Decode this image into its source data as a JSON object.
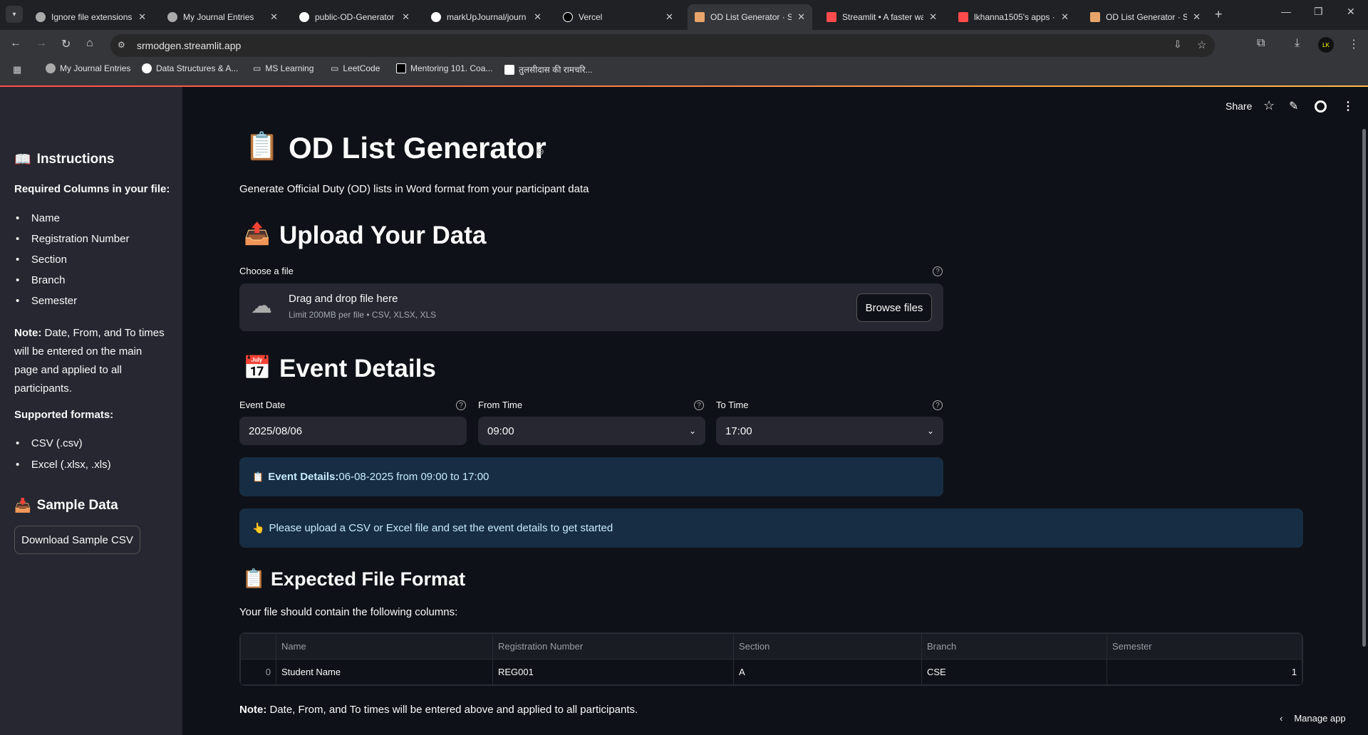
{
  "browser": {
    "tabs": [
      {
        "label": "Ignore file extensions",
        "active": false
      },
      {
        "label": "My Journal Entries",
        "active": false
      },
      {
        "label": "public-OD-Generator",
        "active": false
      },
      {
        "label": "markUpJournal/journ",
        "active": false
      },
      {
        "label": "Vercel",
        "active": false
      },
      {
        "label": "OD List Generator · St",
        "active": true
      },
      {
        "label": "Streamlit • A faster wa",
        "active": false
      },
      {
        "label": "lkhanna1505's apps ·",
        "active": false
      },
      {
        "label": "OD List Generator · St",
        "active": false
      }
    ],
    "url": "srmodgen.streamlit.app",
    "bookmarks": [
      "My Journal Entries",
      "Data Structures & A...",
      "MS Learning",
      "LeetCode",
      "Mentoring 101. Coa...",
      "तुलसीदास की रामचरि..."
    ],
    "profile_initials": "LK"
  },
  "app_toolbar": {
    "share": "Share"
  },
  "sidebar": {
    "instructions_title": "Instructions",
    "required_title": "Required Columns in your file:",
    "required_items": [
      "Name",
      "Registration Number",
      "Section",
      "Branch",
      "Semester"
    ],
    "note_label": "Note:",
    "note_lines": [
      " Date, From, and To times",
      "will be entered on the main",
      "page and applied to all",
      "participants."
    ],
    "supported_title": "Supported formats:",
    "supported_items": [
      "CSV (.csv)",
      "Excel (.xlsx, .xls)"
    ],
    "sample_title": "Sample Data",
    "download_button": "Download Sample CSV"
  },
  "main": {
    "title": "OD List Generator",
    "subtitle": "Generate Official Duty (OD) lists in Word format from your participant data",
    "upload_heading": "Upload Your Data",
    "file_label": "Choose a file",
    "drop_text": "Drag and drop file here",
    "limit_text": "Limit 200MB per file • CSV, XLSX, XLS",
    "browse_button": "Browse files",
    "event_heading": "Event Details",
    "event_date_label": "Event Date",
    "event_date_value": "2025/08/06",
    "from_label": "From Time",
    "from_value": "09:00",
    "to_label": "To Time",
    "to_value": "17:00",
    "event_summary_label": "Event Details:",
    "event_summary_text": " 06-08-2025 from 09:00 to 17:00",
    "info_text": "Please upload a CSV or Excel file and set the event details to get started",
    "format_heading": "Expected File Format",
    "format_intro": "Your file should contain the following columns:",
    "table": {
      "columns": [
        "",
        "Name",
        "Registration Number",
        "Section",
        "Branch",
        "Semester"
      ],
      "rows": [
        [
          "0",
          "Student Name",
          "REG001",
          "A",
          "CSE",
          "1"
        ]
      ]
    },
    "note_label": "Note:",
    "note_text": " Date, From, and To times will be entered above and applied to all participants.",
    "manage_app": "Manage app"
  }
}
